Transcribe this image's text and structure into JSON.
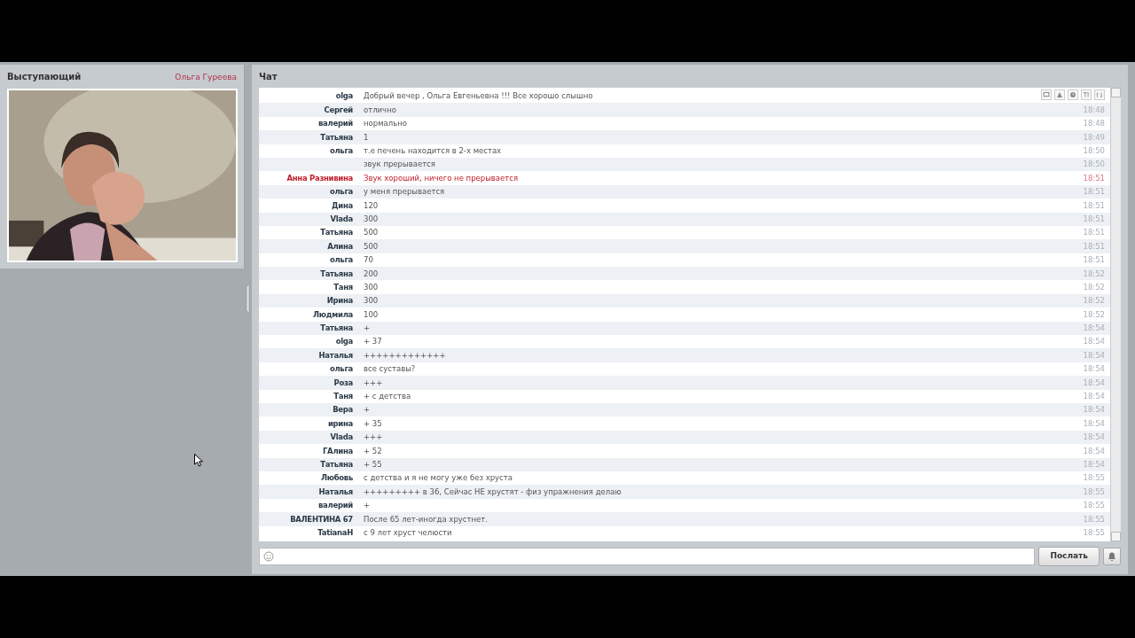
{
  "presenter_panel": {
    "title": "Выступающий",
    "presenter_name": "Ольга  Гуреева"
  },
  "chat_panel": {
    "title": "Чат",
    "messages": [
      {
        "author": "olga",
        "text": "Добрый  вечер , Ольга Евгеньевна !!! Все хорошо слышно",
        "highlighted": false
      },
      {
        "author": "Сергей",
        "text": "отлично",
        "time": "18:48",
        "highlighted": false
      },
      {
        "author": "валерий",
        "text": "нормально",
        "time": "18:48",
        "highlighted": false
      },
      {
        "author": "Татьяна",
        "text": "1",
        "time": "18:49",
        "highlighted": false
      },
      {
        "author": "ольга",
        "text": "т.е печень находится в 2-х местах",
        "time": "18:50",
        "highlighted": false
      },
      {
        "text": "звук прерывается",
        "time": "18:50",
        "highlighted": false
      },
      {
        "author": "Анна Разнивина",
        "text": "Звук хороший, ничего не прерывается",
        "time": "18:51",
        "highlighted": true
      },
      {
        "author": "ольга",
        "text": "у меня прерывается",
        "time": "18:51",
        "highlighted": false
      },
      {
        "author": "Дина",
        "text": "120",
        "time": "18:51",
        "highlighted": false
      },
      {
        "author": "Vlada",
        "text": "300",
        "time": "18:51",
        "highlighted": false
      },
      {
        "author": "Татьяна",
        "text": "500",
        "time": "18:51",
        "highlighted": false
      },
      {
        "author": "Алина",
        "text": "500",
        "time": "18:51",
        "highlighted": false
      },
      {
        "author": "ольга",
        "text": "70",
        "time": "18:51",
        "highlighted": false
      },
      {
        "author": "Татьяна",
        "text": "200",
        "time": "18:52",
        "highlighted": false
      },
      {
        "author": "Таня",
        "text": "300",
        "time": "18:52",
        "highlighted": false
      },
      {
        "author": "Ирина",
        "text": "300",
        "time": "18:52",
        "highlighted": false
      },
      {
        "author": "Людмила",
        "text": "100",
        "time": "18:52",
        "highlighted": false
      },
      {
        "author": "Татьяна",
        "text": "+",
        "time": "18:54",
        "highlighted": false
      },
      {
        "author": "olga",
        "text": "+ 37",
        "time": "18:54",
        "highlighted": false
      },
      {
        "author": "Наталья",
        "text": "+++++++++++++",
        "time": "18:54",
        "highlighted": false
      },
      {
        "author": "ольга",
        "text": "все суставы?",
        "time": "18:54",
        "highlighted": false
      },
      {
        "author": "Роза",
        "text": "+++",
        "time": "18:54",
        "highlighted": false
      },
      {
        "author": "Таня",
        "text": "+ с детства",
        "time": "18:54",
        "highlighted": false
      },
      {
        "author": "Вера",
        "text": "+",
        "time": "18:54",
        "highlighted": false
      },
      {
        "author": "ирина",
        "text": "+ 35",
        "time": "18:54",
        "highlighted": false
      },
      {
        "author": "Vlada",
        "text": "+++",
        "time": "18:54",
        "highlighted": false
      },
      {
        "author": "ГАлина",
        "text": "+  52",
        "time": "18:54",
        "highlighted": false
      },
      {
        "author": "Татьяна",
        "text": "+ 55",
        "time": "18:54",
        "highlighted": false
      },
      {
        "author": "Любовь",
        "text": "с детства и я не могу уже без хруста",
        "time": "18:55",
        "highlighted": false
      },
      {
        "author": "Наталья",
        "text": "+++++++++ в 36, Сейчас НЕ хрустят - физ упражнения делаю",
        "time": "18:55",
        "highlighted": false
      },
      {
        "author": "валерий",
        "text": "+",
        "time": "18:55",
        "highlighted": false
      },
      {
        "author": "ВАЛЕНТИНА 67",
        "text": "После 65 лет-иногда хрустнет.",
        "time": "18:55",
        "highlighted": false
      },
      {
        "author": "TatianaH",
        "text": "с 9 лет хруст челюсти",
        "time": "18:55",
        "highlighted": false
      }
    ],
    "send_button": "Послать"
  }
}
